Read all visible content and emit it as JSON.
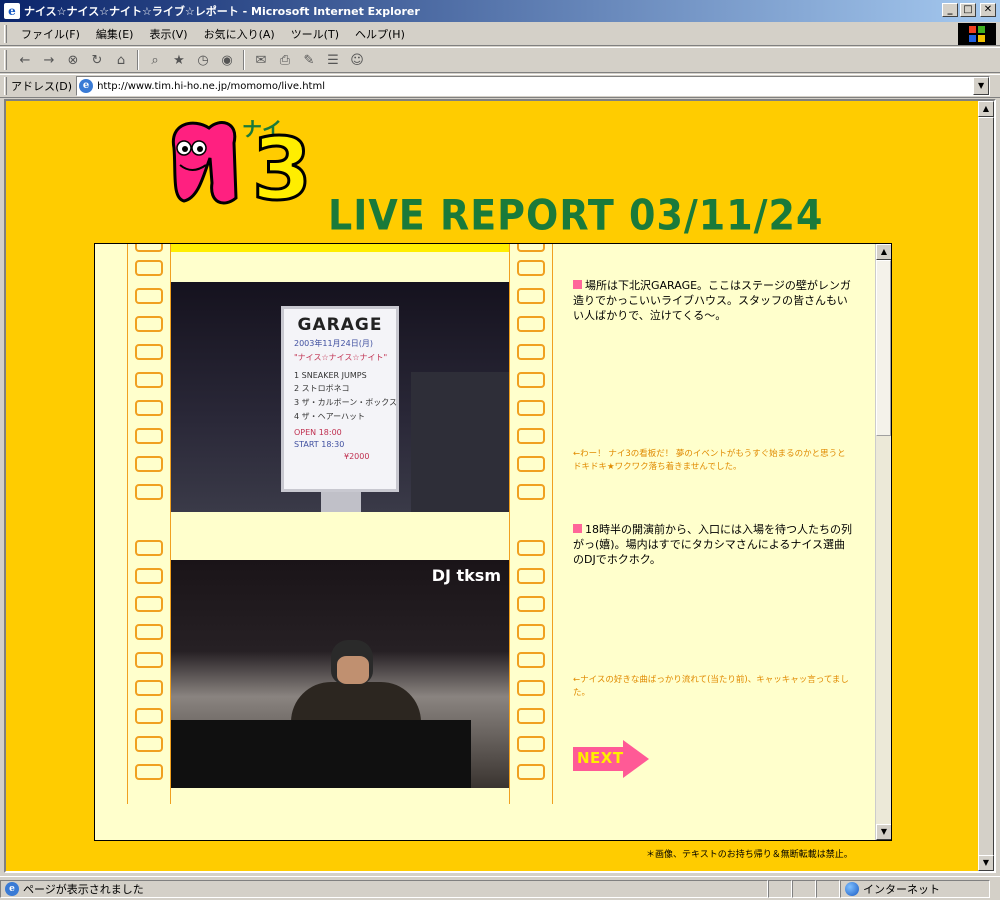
{
  "window": {
    "title": "ナイス☆ナイス☆ナイト☆ライブ☆レポート - Microsoft Internet Explorer",
    "minimize": "_",
    "maximize": "□",
    "close": "✕"
  },
  "menu": {
    "items": [
      "ファイル(F)",
      "編集(E)",
      "表示(V)",
      "お気に入り(A)",
      "ツール(T)",
      "ヘルプ(H)"
    ]
  },
  "toolbar": {
    "icons": [
      "back-icon",
      "forward-icon",
      "stop-icon",
      "refresh-icon",
      "home-icon",
      "search-icon",
      "favorites-icon",
      "history-icon",
      "media-icon",
      "mail-icon",
      "print-icon",
      "edit-icon",
      "discuss-icon",
      "messenger-icon"
    ],
    "back": "←",
    "forward": "→",
    "stop": "⊗",
    "refresh": "↻",
    "home": "⌂",
    "search": "⌕",
    "favorites": "★",
    "history": "◷",
    "media": "◉",
    "mail": "✉",
    "print": "⎙",
    "edit": "✎",
    "discuss": "☰",
    "messenger": "☺"
  },
  "address": {
    "label": "アドレス(D)",
    "url": "http://www.tim.hi-ho.ne.jp/momomo/live.html"
  },
  "page": {
    "logo_kana": "ナイ",
    "logo_number": "3",
    "report_title": "LIVE REPORT  03/11/24",
    "garage_sign": {
      "name": "GARAGE",
      "date": "2003年11月24日(月)",
      "event": "\"ナイス☆ナイス☆ナイト\"",
      "lineup": [
        "1  SNEAKER JUMPS",
        "2  ストロボネコ",
        "3  ザ・カルボーン・ボックス",
        "4  ザ・ヘアーハット"
      ],
      "open": "OPEN 18:00",
      "start": "START 18:30",
      "price": "¥2000"
    },
    "photo2_label": "DJ tksm",
    "entries": [
      {
        "text": "場所は下北沢GARAGE。ここはステージの壁がレンガ造りでかっこいいライブハウス。スタッフの皆さんもいい人ばかりで、泣けてくる〜。",
        "caption": "←わー！ ナイ3の看板だ！ 夢のイベントがもうすぐ始まるのかと思うとドキドキ★ワクワク落ち着きませんでした。"
      },
      {
        "text": "18時半の開演前から、入口には入場を待つ人たちの列がっ(嬉)。場内はすでにタカシマさんによるナイス選曲のDJでホクホク。",
        "caption": "←ナイスの好きな曲ばっかり流れて(当たり前)、キャッキャッ言ってました。"
      }
    ],
    "next_label": "NEXT",
    "copyright": "＊画像、テキストのお持ち帰り＆無断転載は禁止。"
  },
  "status": {
    "text": "ページが表示されました",
    "zone": "インターネット"
  },
  "colors": {
    "page_bg": "#ffcc00",
    "frame_bg": "#ffffcc",
    "title_green": "#1a7a3a",
    "accent_pink": "#ff5a96",
    "caption_orange": "#e08a00"
  }
}
